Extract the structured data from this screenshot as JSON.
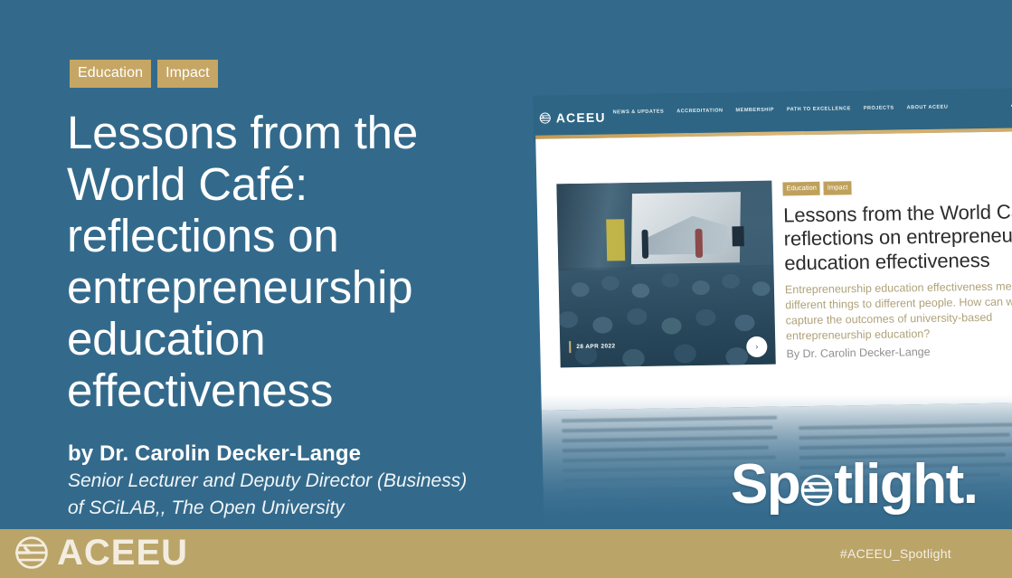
{
  "slide": {
    "background_color": "#336a8c",
    "accent_gold": "#bba468",
    "tag_gold": "#c6a664"
  },
  "left": {
    "tags": [
      "Education",
      "Impact"
    ],
    "title": "Lessons from the World Café: reflections on entrepreneurship education effectiveness",
    "author": "by Dr. Carolin Decker-Lange",
    "role_line_1": "Senior Lecturer and Deputy Director (Business)",
    "role_line_2": "of SCiLAB,, The Open University"
  },
  "website": {
    "logo_text": "ACEEU",
    "nav": [
      "NEWS & UPDATES",
      "ACCREDITATION",
      "MEMBERSHIP",
      "PATH TO EXCELLENCE",
      "PROJECTS",
      "ABOUT ACEEU"
    ],
    "social_icons": [
      "user-icon",
      "facebook-icon",
      "twitter-icon",
      "youtube-icon"
    ],
    "thumbnail": {
      "date": "28 APR 2022",
      "next_arrow": "›"
    },
    "article": {
      "tags": [
        "Education",
        "Impact"
      ],
      "title": "Lessons from the World Café: reflections on entrepreneurship education effectiveness",
      "lead": "Entrepreneurship education effectiveness means different things to different people. How can we best capture the outcomes of university-based entrepreneurship education?",
      "byline": "By Dr. Carolin Decker-Lange"
    }
  },
  "watermark": {
    "text_before": "Sp",
    "text_after": "tlight."
  },
  "footer": {
    "logo_text": "ACEEU",
    "hashtag": "#ACEEU_Spotlight"
  }
}
